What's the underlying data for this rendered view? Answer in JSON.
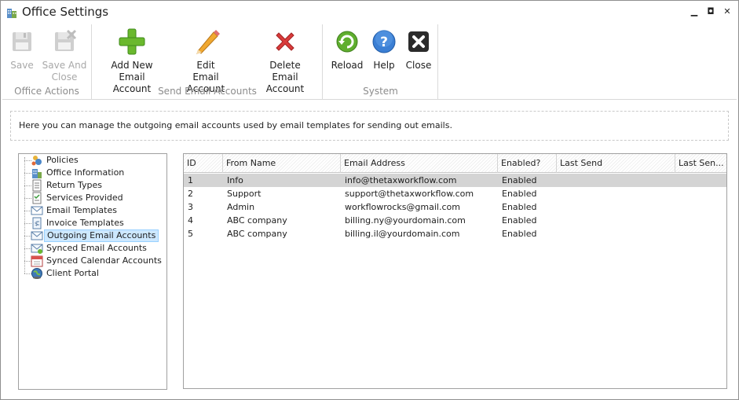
{
  "window": {
    "title": "Office Settings",
    "app_icon": "office-building-icon"
  },
  "window_controls": {
    "minimize": "▁",
    "maximize": "◘",
    "close": "✕"
  },
  "ribbon": {
    "groups": [
      {
        "label": "Office Actions",
        "buttons": [
          {
            "label_line1": "Save",
            "label_line2": "",
            "icon": "floppy-disk-icon",
            "enabled": false
          },
          {
            "label_line1": "Save And",
            "label_line2": "Close",
            "icon": "floppy-disk-close-icon",
            "enabled": false
          }
        ]
      },
      {
        "label": "Send Email Accounts",
        "buttons": [
          {
            "label_line1": "Add New",
            "label_line2": "Email Account",
            "icon": "green-plus-icon",
            "enabled": true
          },
          {
            "label_line1": "Edit",
            "label_line2": "Email Account",
            "icon": "pencil-icon",
            "enabled": true
          },
          {
            "label_line1": "Delete",
            "label_line2": "Email Account",
            "icon": "red-x-icon",
            "enabled": true
          }
        ]
      },
      {
        "label": "System",
        "buttons": [
          {
            "label_line1": "Reload",
            "label_line2": "",
            "icon": "reload-icon",
            "enabled": true
          },
          {
            "label_line1": "Help",
            "label_line2": "",
            "icon": "help-icon",
            "enabled": true
          },
          {
            "label_line1": "Close",
            "label_line2": "",
            "icon": "close-box-icon",
            "enabled": true
          }
        ]
      }
    ]
  },
  "info": {
    "text": "Here you can manage the outgoing email accounts used by email templates for sending out emails."
  },
  "tree": {
    "items": [
      {
        "label": "Policies",
        "icon": "policies-icon"
      },
      {
        "label": "Office Information",
        "icon": "office-info-icon"
      },
      {
        "label": "Return Types",
        "icon": "document-icon"
      },
      {
        "label": "Services Provided",
        "icon": "checklist-icon"
      },
      {
        "label": "Email Templates",
        "icon": "email-template-icon"
      },
      {
        "label": "Invoice Templates",
        "icon": "invoice-icon"
      },
      {
        "label": "Outgoing Email Accounts",
        "icon": "envelope-icon",
        "selected": true
      },
      {
        "label": "Synced Email Accounts",
        "icon": "synced-envelope-icon"
      },
      {
        "label": "Synced Calendar Accounts",
        "icon": "calendar-icon"
      },
      {
        "label": "Client Portal",
        "icon": "globe-icon"
      }
    ]
  },
  "grid": {
    "columns": [
      "ID",
      "From Name",
      "Email Address",
      "Enabled?",
      "Last Send",
      "Last Sen..."
    ],
    "rows": [
      {
        "id": "1",
        "from_name": "Info",
        "email": "info@thetaxworkflow.com",
        "enabled": "Enabled",
        "last_send": "",
        "last_send2": "",
        "selected": true
      },
      {
        "id": "2",
        "from_name": "Support",
        "email": "support@thetaxworkflow.com",
        "enabled": "Enabled",
        "last_send": "",
        "last_send2": ""
      },
      {
        "id": "3",
        "from_name": "Admin",
        "email": "workflowrocks@gmail.com",
        "enabled": "Enabled",
        "last_send": "",
        "last_send2": ""
      },
      {
        "id": "4",
        "from_name": "ABC company",
        "email": "billing.ny@yourdomain.com",
        "enabled": "Enabled",
        "last_send": "",
        "last_send2": ""
      },
      {
        "id": "5",
        "from_name": "ABC company",
        "email": "billing.il@yourdomain.com",
        "enabled": "Enabled",
        "last_send": "",
        "last_send2": ""
      }
    ]
  },
  "colors": {
    "selection": "#cde8ff",
    "row_selected": "#d4d4d4",
    "disabled_text": "#a8a8a8",
    "group_label": "#8c8c8c"
  }
}
